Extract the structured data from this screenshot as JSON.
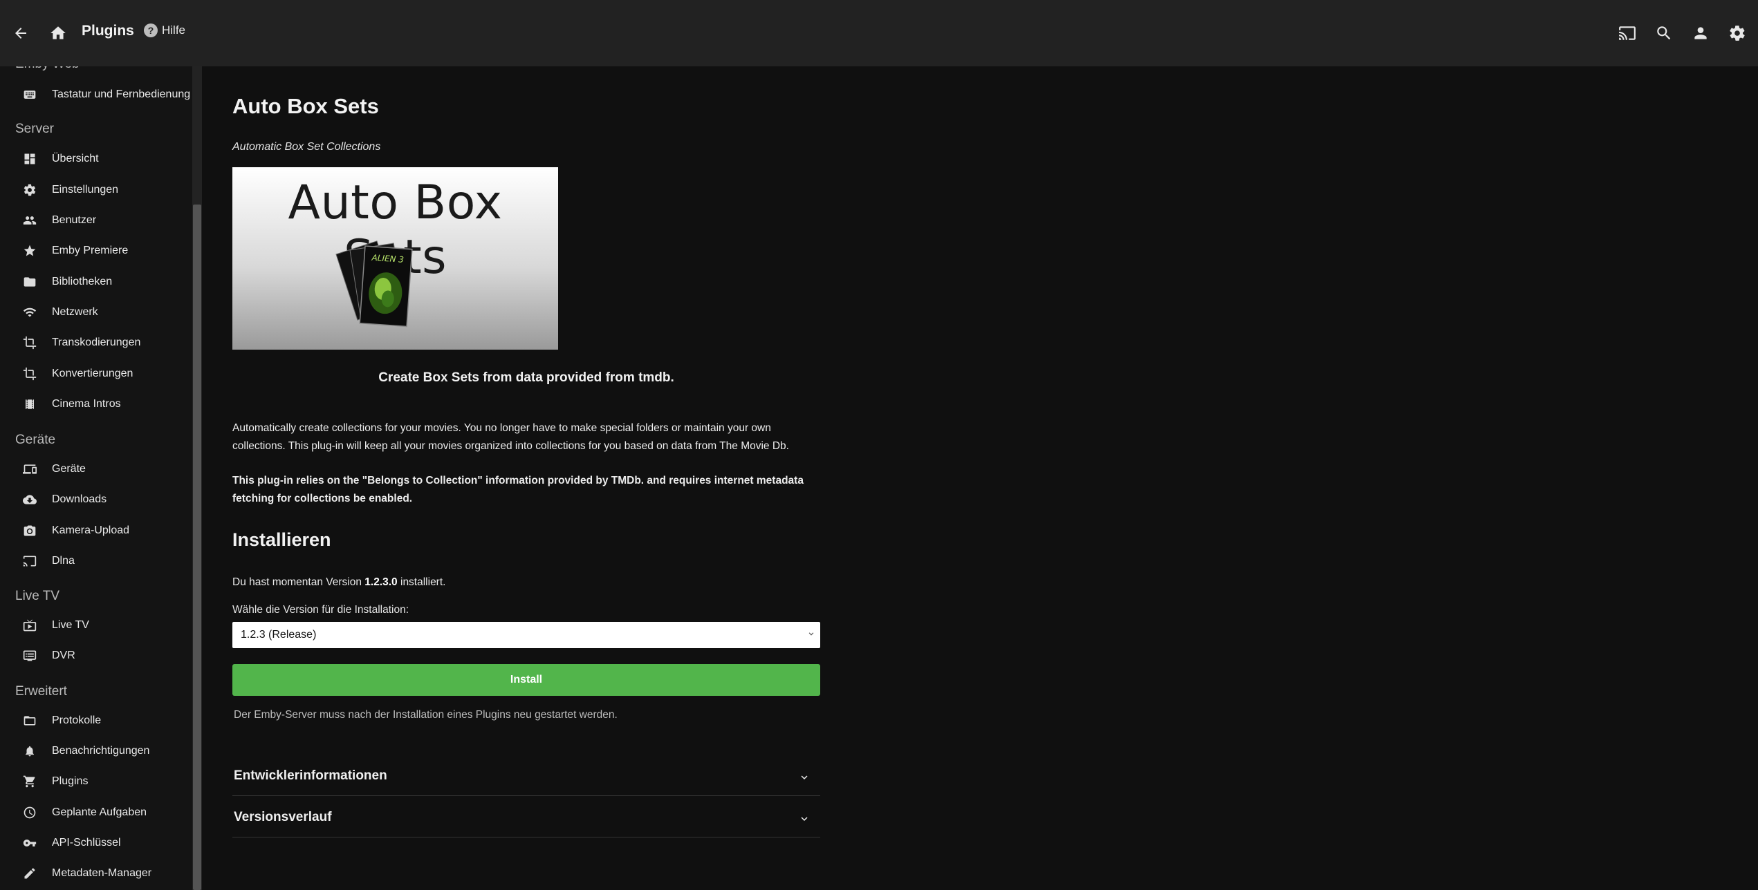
{
  "header": {
    "title": "Plugins",
    "help_label": "Hilfe",
    "help_glyph": "?"
  },
  "sidebar": {
    "partial_section": "Emby Web",
    "groups": [
      {
        "title": "",
        "items": [
          {
            "label": "Tastatur und Fernbedienung",
            "icon": "keyboard-icon"
          }
        ]
      },
      {
        "title": "Server",
        "items": [
          {
            "label": "Übersicht",
            "icon": "dashboard-icon"
          },
          {
            "label": "Einstellungen",
            "icon": "gear-icon"
          },
          {
            "label": "Benutzer",
            "icon": "people-icon"
          },
          {
            "label": "Emby Premiere",
            "icon": "star-icon"
          },
          {
            "label": "Bibliotheken",
            "icon": "folder-icon"
          },
          {
            "label": "Netzwerk",
            "icon": "wifi-icon"
          },
          {
            "label": "Transkodierungen",
            "icon": "crop-icon"
          },
          {
            "label": "Konvertierungen",
            "icon": "crop-icon"
          },
          {
            "label": "Cinema Intros",
            "icon": "film-icon"
          }
        ]
      },
      {
        "title": "Geräte",
        "items": [
          {
            "label": "Geräte",
            "icon": "devices-icon"
          },
          {
            "label": "Downloads",
            "icon": "cloud-download-icon"
          },
          {
            "label": "Kamera-Upload",
            "icon": "camera-icon"
          },
          {
            "label": "Dlna",
            "icon": "cast-screen-icon"
          }
        ]
      },
      {
        "title": "Live TV",
        "items": [
          {
            "label": "Live TV",
            "icon": "tv-icon"
          },
          {
            "label": "DVR",
            "icon": "dvr-icon"
          }
        ]
      },
      {
        "title": "Erweitert",
        "items": [
          {
            "label": "Protokolle",
            "icon": "folder-outline-icon"
          },
          {
            "label": "Benachrichtigungen",
            "icon": "bell-icon"
          },
          {
            "label": "Plugins",
            "icon": "cart-icon"
          },
          {
            "label": "Geplante Aufgaben",
            "icon": "clock-icon"
          },
          {
            "label": "API-Schlüssel",
            "icon": "key-icon"
          },
          {
            "label": "Metadaten-Manager",
            "icon": "pencil-icon"
          }
        ]
      }
    ]
  },
  "plugin": {
    "name": "Auto Box Sets",
    "subtitle": "Automatic Box Set Collections",
    "image_text": "Auto Box Sets",
    "poster_text": "ALIEN 3",
    "tagline": "Create Box Sets from data provided from tmdb.",
    "description": "Automatically create collections for your movies. You no longer have to make special folders or maintain your own collections. This plug-in will keep all your movies organized into collections for you based on data from The Movie Db.",
    "note_bold": "This plug-in relies on the \"Belongs to Collection\" information provided by TMDb. and requires internet metadata fetching for collections be enabled."
  },
  "install": {
    "heading": "Installieren",
    "current_prefix": "Du hast momentan Version ",
    "current_version": "1.2.3.0",
    "current_suffix": " installiert.",
    "select_label": "Wähle die Version für die Installation:",
    "selected_version": "1.2.3 (Release)",
    "button_label": "Install",
    "restart_note": "Der Emby-Server muss nach der Installation eines Plugins neu gestartet werden."
  },
  "sections": {
    "developer": "Entwicklerinformationen",
    "history": "Versionsverlauf"
  },
  "colors": {
    "accent_green": "#52b54b",
    "header_bg": "#222222",
    "page_bg": "#101010"
  }
}
